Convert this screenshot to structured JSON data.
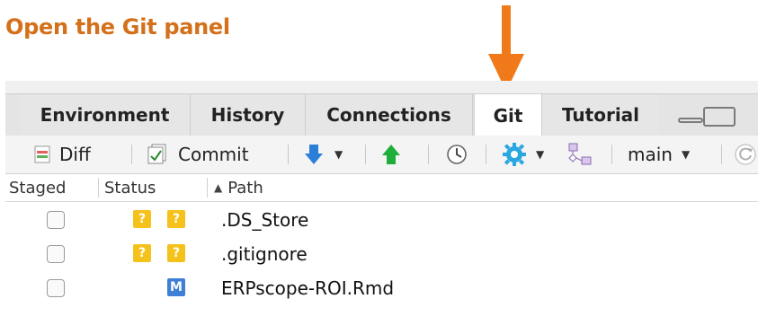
{
  "heading": "Open the Git panel",
  "colors": {
    "accent": "#d4701a",
    "arrow": "#f07a1a",
    "untracked": "#f4c21a",
    "modified": "#3f7fd6"
  },
  "tabs": [
    {
      "label": "Environment",
      "active": false
    },
    {
      "label": "History",
      "active": false
    },
    {
      "label": "Connections",
      "active": false
    },
    {
      "label": "Git",
      "active": true
    },
    {
      "label": "Tutorial",
      "active": false
    }
  ],
  "toolbar": {
    "diff_label": "Diff",
    "commit_label": "Commit",
    "pull_icon": "pull-down-arrow-icon",
    "push_icon": "push-up-arrow-icon",
    "history_icon": "clock-icon",
    "more_icon": "gear-icon",
    "branch_icon": "branch-icon",
    "branch_label": "main",
    "refresh_icon": "refresh-icon"
  },
  "columns": {
    "staged": "Staged",
    "status": "Status",
    "path": "Path",
    "sort_indicator": "▲"
  },
  "files": [
    {
      "path": ".DS_Store",
      "status": [
        "?",
        "?"
      ],
      "staged": false
    },
    {
      "path": ".gitignore",
      "status": [
        "?",
        "?"
      ],
      "staged": false
    },
    {
      "path": "ERPscope-ROI.Rmd",
      "status": [
        "",
        "M"
      ],
      "staged": false
    }
  ]
}
